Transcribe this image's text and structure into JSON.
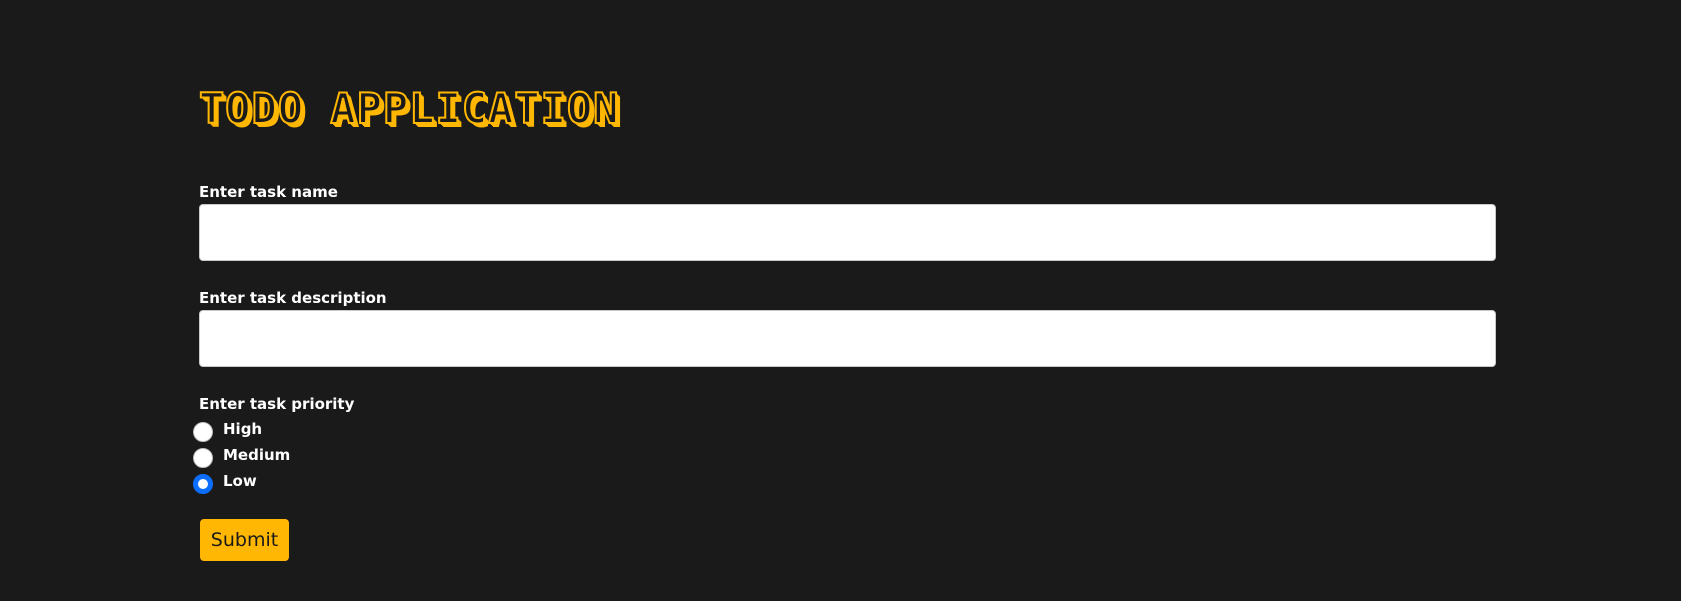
{
  "app": {
    "title": "TODO APPLICATION"
  },
  "form": {
    "task_name": {
      "label": "Enter task name",
      "value": "",
      "placeholder": ""
    },
    "task_description": {
      "label": "Enter task description",
      "value": "",
      "placeholder": ""
    },
    "task_priority": {
      "label": "Enter task priority",
      "options": [
        {
          "label": "High",
          "checked": false
        },
        {
          "label": "Medium",
          "checked": false
        },
        {
          "label": "Low",
          "checked": true
        }
      ]
    },
    "submit_label": "Submit"
  },
  "colors": {
    "background": "#191a19",
    "accent": "#ffb703",
    "radio_selected": "#0d6efd"
  }
}
